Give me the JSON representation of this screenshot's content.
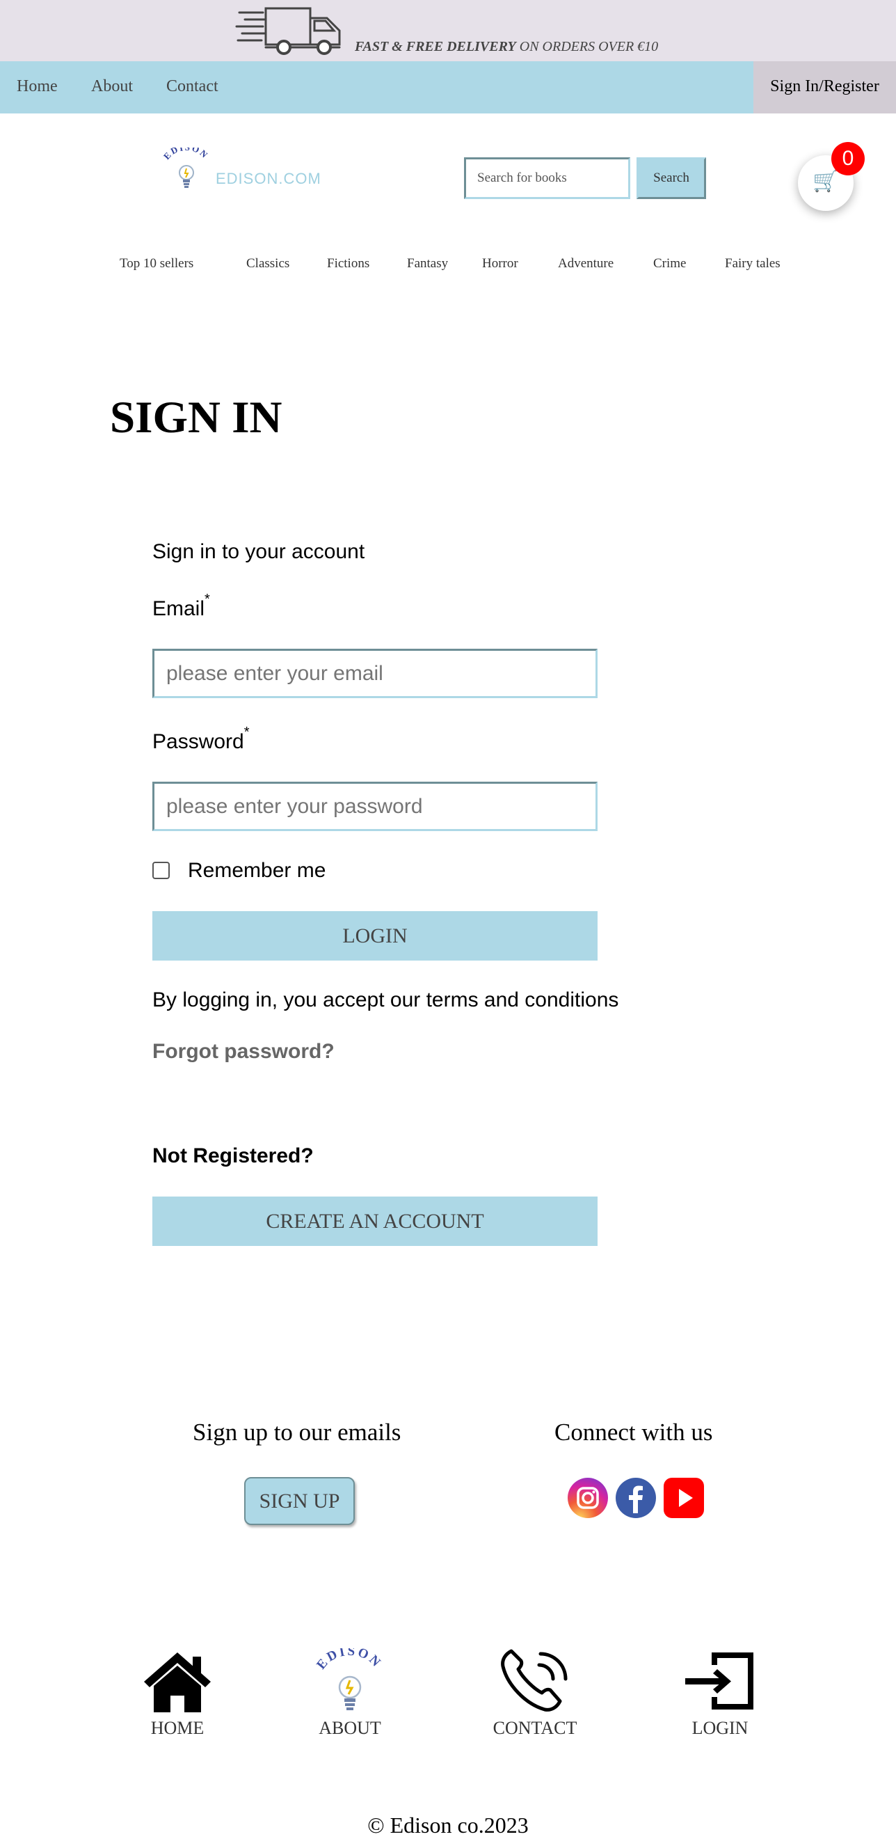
{
  "promo": {
    "bold_text": "FAST & FREE DELIVERY",
    "rest_text": " ON ORDERS OVER €10"
  },
  "nav": {
    "links": [
      "Home",
      "About",
      "Contact"
    ],
    "signin": "Sign In/Register"
  },
  "header": {
    "logo_arc_text": "EDISON",
    "logo_word": "EDISON.COM",
    "search_placeholder": "Search for books",
    "search_button": "Search",
    "cart_count": "0"
  },
  "categories": [
    "Top 10 sellers",
    "Classics",
    "Fictions",
    "Fantasy",
    "Horror",
    "Adventure",
    "Crime",
    "Fairy tales"
  ],
  "page_title": "SIGN IN",
  "form": {
    "subtitle": "Sign in to your account",
    "email_label": "Email",
    "email_placeholder": "please enter your email",
    "password_label": "Password",
    "password_placeholder": "please enter your password",
    "required_mark": "*",
    "remember_label": "Remember me",
    "login_button": "LOGIN",
    "terms_text": "By logging in, you accept our terms and conditions",
    "forgot_link": "Forgot password?",
    "not_registered": "Not Registered?",
    "create_button": "CREATE AN ACCOUNT"
  },
  "footer": {
    "emails_heading": "Sign up to our emails",
    "signup_button": "SIGN UP",
    "connect_heading": "Connect with us",
    "social_icons": [
      "instagram-icon",
      "facebook-icon",
      "youtube-icon"
    ],
    "nav_labels": [
      "HOME",
      "ABOUT",
      "CONTACT",
      "LOGIN"
    ],
    "copyright": "© Edison co.2023"
  },
  "colors": {
    "accent": "#add8e6",
    "promo_bg": "#e6e1e9",
    "signin_tab_bg": "#d2ccd4",
    "badge": "#ff0000"
  }
}
